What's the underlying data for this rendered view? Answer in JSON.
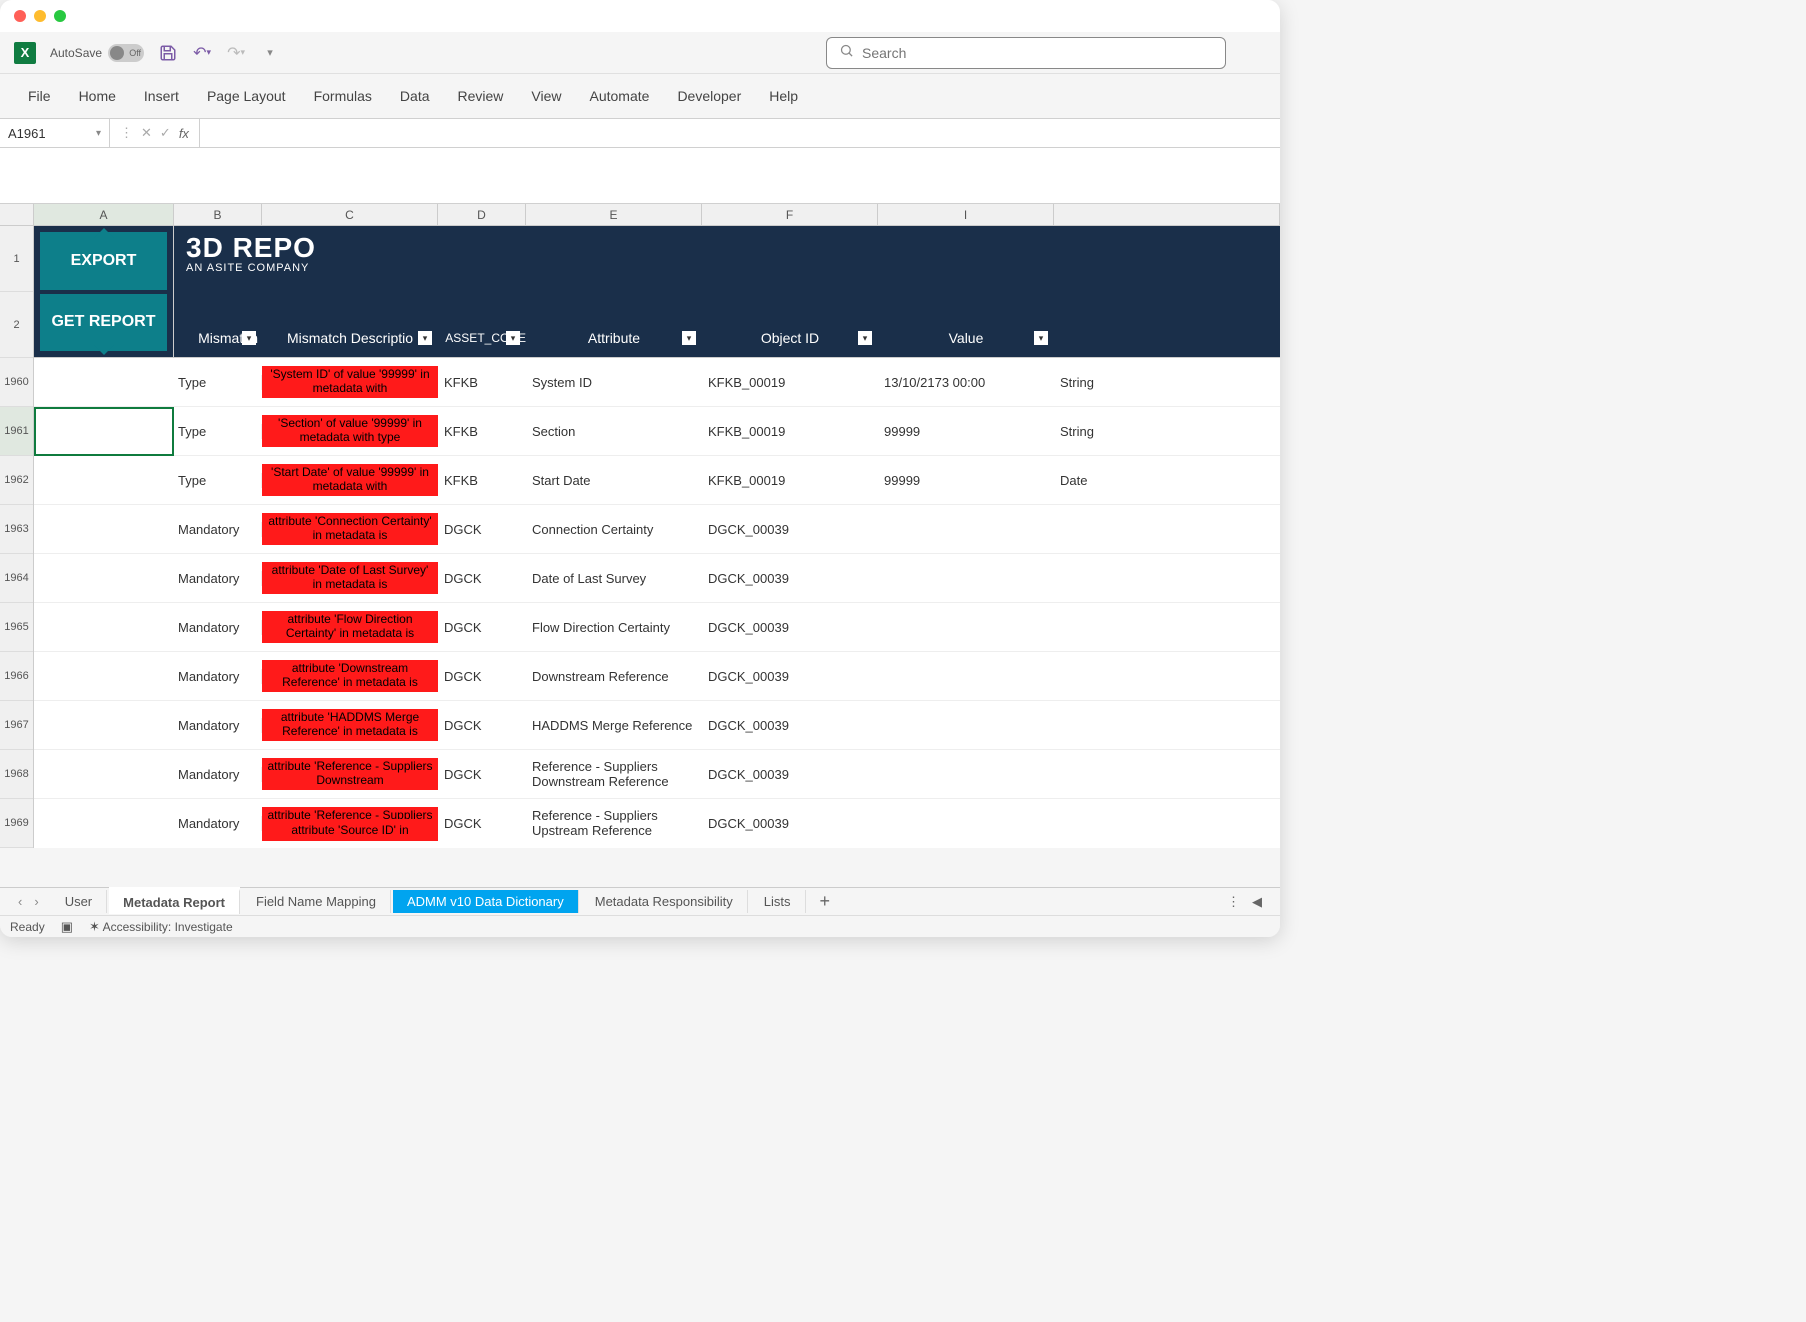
{
  "window": {
    "autosave_label": "AutoSave",
    "autosave_state": "Off"
  },
  "search": {
    "placeholder": "Search"
  },
  "ribbon": [
    "File",
    "Home",
    "Insert",
    "Page Layout",
    "Formulas",
    "Data",
    "Review",
    "View",
    "Automate",
    "Developer",
    "Help"
  ],
  "namebox": "A1961",
  "col_letters": [
    "A",
    "B",
    "C",
    "D",
    "E",
    "F",
    "I"
  ],
  "banner": {
    "export_btn": "EXPORT",
    "get_report_btn": "GET REPORT",
    "brand": "3D REPO",
    "brand_sub": "AN ASITE COMPANY"
  },
  "table_headers": {
    "mismatch": "Mismatch",
    "desc": "Mismatch Descriptio",
    "asset": "ASSET_CODE",
    "attr": "Attribute",
    "objid": "Object ID",
    "value": "Value"
  },
  "row_nums": [
    "1960",
    "1961",
    "1962",
    "1963",
    "1964",
    "1965",
    "1966",
    "1967",
    "1968",
    "1969"
  ],
  "rows": [
    {
      "mismatch": "Type",
      "desc": "'System ID' of value '99999' in metadata with",
      "asset": "KFKB",
      "attr": "System ID",
      "objid": "KFKB_00019",
      "value": "13/10/2173 00:00",
      "rest": "String"
    },
    {
      "mismatch": "Type",
      "desc": "'Section' of value '99999' in metadata with type",
      "asset": "KFKB",
      "attr": "Section",
      "objid": "KFKB_00019",
      "value": "99999",
      "rest": "String"
    },
    {
      "mismatch": "Type",
      "desc": "'Start Date' of value '99999' in metadata with",
      "asset": "KFKB",
      "attr": "Start Date",
      "objid": "KFKB_00019",
      "value": "99999",
      "rest": "Date"
    },
    {
      "mismatch": "Mandatory",
      "desc": "attribute 'Connection Certainty' in metadata is",
      "asset": "DGCK",
      "attr": "Connection Certainty",
      "objid": "DGCK_00039",
      "value": "",
      "rest": ""
    },
    {
      "mismatch": "Mandatory",
      "desc": "attribute 'Date of Last Survey' in metadata is",
      "asset": "DGCK",
      "attr": "Date of Last Survey",
      "objid": "DGCK_00039",
      "value": "",
      "rest": ""
    },
    {
      "mismatch": "Mandatory",
      "desc": "attribute 'Flow Direction Certainty' in metadata is",
      "asset": "DGCK",
      "attr": "Flow Direction Certainty",
      "objid": "DGCK_00039",
      "value": "",
      "rest": ""
    },
    {
      "mismatch": "Mandatory",
      "desc": "attribute 'Downstream Reference' in metadata is",
      "asset": "DGCK",
      "attr": "Downstream Reference",
      "objid": "DGCK_00039",
      "value": "",
      "rest": ""
    },
    {
      "mismatch": "Mandatory",
      "desc": "attribute 'HADDMS Merge Reference' in metadata is",
      "asset": "DGCK",
      "attr": "HADDMS Merge Reference",
      "objid": "DGCK_00039",
      "value": "",
      "rest": ""
    },
    {
      "mismatch": "Mandatory",
      "desc": "attribute 'Reference - Suppliers Downstream",
      "asset": "DGCK",
      "attr": "Reference - Suppliers Downstream Reference",
      "objid": "DGCK_00039",
      "value": "",
      "rest": ""
    },
    {
      "mismatch": "Mandatory",
      "desc": "attribute 'Reference - Suppliers Upstream",
      "asset": "DGCK",
      "attr": "Reference - Suppliers Upstream Reference",
      "objid": "DGCK_00039",
      "value": "",
      "rest": ""
    }
  ],
  "bottom_red": "attribute 'Source ID' in",
  "sheets": {
    "user": "User",
    "metadata_report": "Metadata Report",
    "field_mapping": "Field Name Mapping",
    "admm": "ADMM v10 Data Dictionary",
    "responsibility": "Metadata Responsibility",
    "lists": "Lists"
  },
  "status": {
    "ready": "Ready",
    "accessibility": "Accessibility: Investigate"
  }
}
